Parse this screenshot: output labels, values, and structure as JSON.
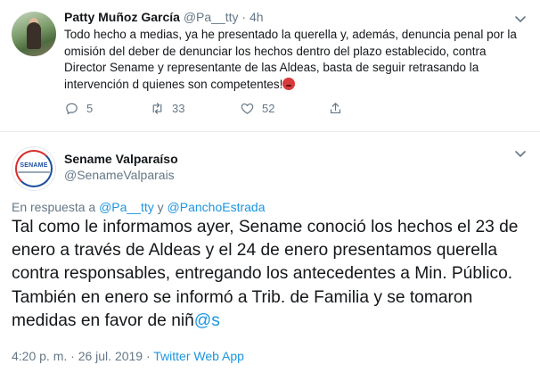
{
  "tweet1": {
    "author_name": "Patty Muñoz García",
    "handle": "@Pa__tty",
    "separator": "·",
    "time": "4h",
    "text": "Todo hecho a medias, ya he presentado la querella y, además, denuncia penal por la omisión del deber de denunciar los hechos dentro del plazo establecido, contra Director Sename y representante de las Aldeas, basta de seguir retrasando la intervención d quienes son competentes!",
    "emoji": "angry-face",
    "actions": {
      "reply_count": "5",
      "retweet_count": "33",
      "like_count": "52"
    }
  },
  "tweet2": {
    "author_name": "Sename Valparaíso",
    "handle": "@SenameValparais",
    "avatar_logo_text": "SENAME",
    "reply_prefix": "En respuesta a ",
    "reply_mention_1": "@Pa__tty",
    "reply_joiner": " y ",
    "reply_mention_2": "@PanchoEstrada",
    "text": "Tal como le informamos ayer, Sename conoció los hechos el 23 de enero a través de Aldeas y el 24 de enero presentamos querella contra responsables, entregando los antecedentes a Min. Público. También en enero se informó a Trib. de Familia y se tomaron medidas en favor de niñ",
    "text_mention": "@s",
    "timestamp": "4:20 p. m. · 26 jul. 2019 · ",
    "source": "Twitter Web App"
  },
  "colors": {
    "link": "#1b95e0",
    "secondary_text": "#657786",
    "divider": "#e6ecf0"
  }
}
